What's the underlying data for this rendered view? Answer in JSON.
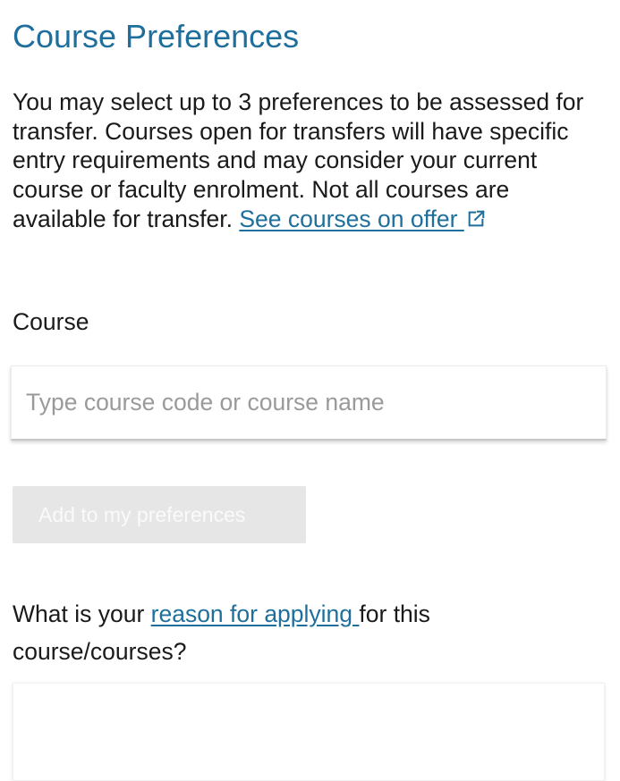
{
  "header": {
    "title": "Course Preferences"
  },
  "intro": {
    "text": "You may select up to 3 preferences to be assessed for transfer. Courses open for transfers will have specific entry requirements and may consider your current course or faculty enrolment. Not all courses are available for transfer. ",
    "link_label": "See courses on offer ",
    "link_icon": "external-link-icon"
  },
  "course_field": {
    "label": "Course",
    "placeholder": "Type course code or course name",
    "value": ""
  },
  "add_button": {
    "label": "Add to my preferences",
    "state": "disabled"
  },
  "reason": {
    "question_before": "What is your ",
    "link_label": "reason for applying ",
    "question_after": "for this course/courses?",
    "value": ""
  },
  "colors": {
    "accent": "#1f6f9c",
    "text": "#1a1a1a",
    "placeholder": "#9a9a9a",
    "button_disabled_bg": "#e6e6e6"
  }
}
